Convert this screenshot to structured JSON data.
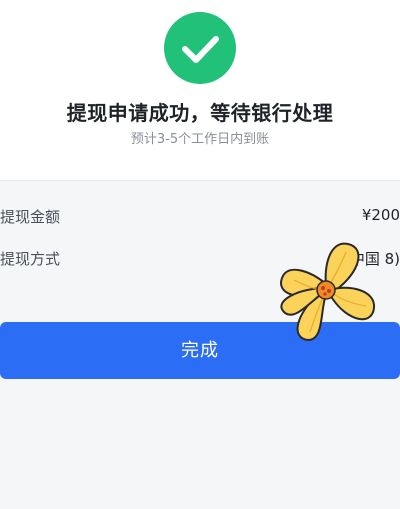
{
  "status": {
    "icon": "check-circle-icon",
    "icon_color": "#22c17a",
    "title": "提现申请成功，等待银行处理",
    "subtitle": "预计3-5个工作日内到账"
  },
  "details": [
    {
      "label": "提现金额",
      "value": "¥200"
    },
    {
      "label": "提现方式",
      "value": "中国                 8)"
    }
  ],
  "done_button": {
    "label": "完成",
    "color": "#2b6ef5"
  },
  "sticker": {
    "icon": "flower-sticker-icon",
    "color": "#fbd35a"
  }
}
